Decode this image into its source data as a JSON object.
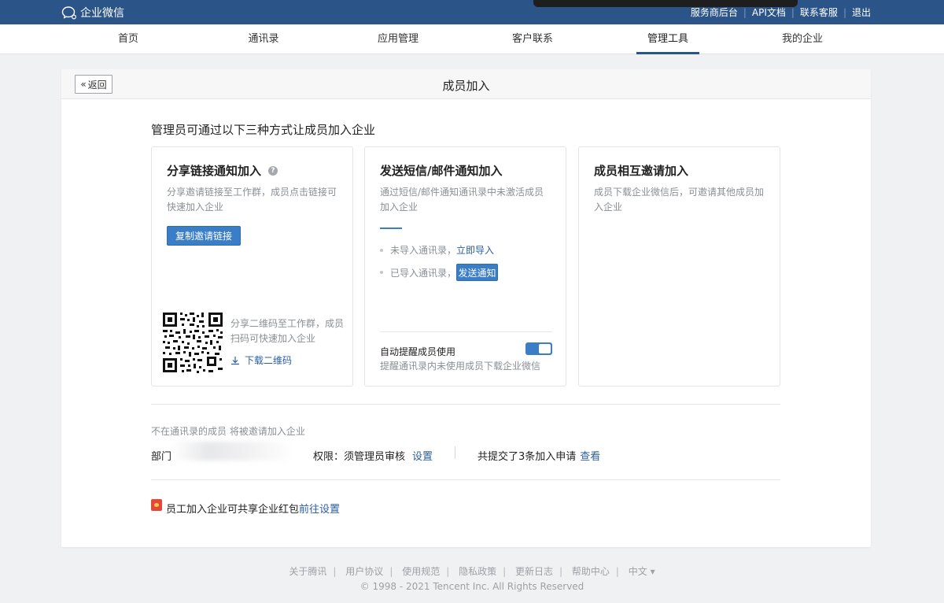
{
  "app": {
    "logo_text": "企业微信"
  },
  "top_links": [
    "服务商后台",
    "API文档",
    "联系客服",
    "退出"
  ],
  "nav": {
    "items": [
      "首页",
      "通讯录",
      "应用管理",
      "客户联系",
      "管理工具",
      "我的企业"
    ],
    "active": "管理工具"
  },
  "page": {
    "back_label": "返回",
    "title": "成员加入",
    "intro": "管理员可通过以下三种方式让成员加入企业"
  },
  "option_link": {
    "title": "分享链接通知加入",
    "desc": "分享邀请链接至工作群，成员点击链接可快速加入企业",
    "copy_button": "复制邀请链接",
    "qr_desc": "分享二维码至工作群，成员扫码可快速加入企业",
    "download_label": "下载二维码"
  },
  "option_sms": {
    "title": "发送短信/邮件通知加入",
    "desc": "通过短信/邮件通知通讯录中未激活成员加入企业",
    "bullet1_text": "未导入通讯录，",
    "bullet1_link": "立即导入",
    "bullet2_text": "已导入通讯录，",
    "bullet2_button": "发送通知",
    "auto_remind_title": "自动提醒成员使用",
    "auto_remind_desc": "提醒通讯录内未使用成员下载企业微信",
    "auto_remind_on": true
  },
  "option_invite": {
    "title": "成员相互邀请加入",
    "desc": "成员下载企业微信后，可邀请其他成员加入企业"
  },
  "settings": {
    "not_in_contacts": "不在通讯录的成员 将被邀请加入企业",
    "dept_label": "部门",
    "permission_label": "权限：",
    "permission_value": "须管理员审核",
    "permission_link": "设置",
    "applications_text": "共提交了3条加入申请",
    "applications_link": "查看"
  },
  "red_packet": {
    "text": "员工加入企业可共享企业红包",
    "link": "前往设置"
  },
  "footer": {
    "links": [
      "关于腾讯",
      "用户协议",
      "使用规范",
      "隐私政策",
      "更新日志",
      "帮助中心"
    ],
    "language": "中文 ▾",
    "copyright": "© 1998 - 2021 Tencent Inc. All Rights Reserved"
  },
  "colors": {
    "header_bg": "#2b5488",
    "accent": "#3b7ec8",
    "link": "#2b5e9e"
  }
}
